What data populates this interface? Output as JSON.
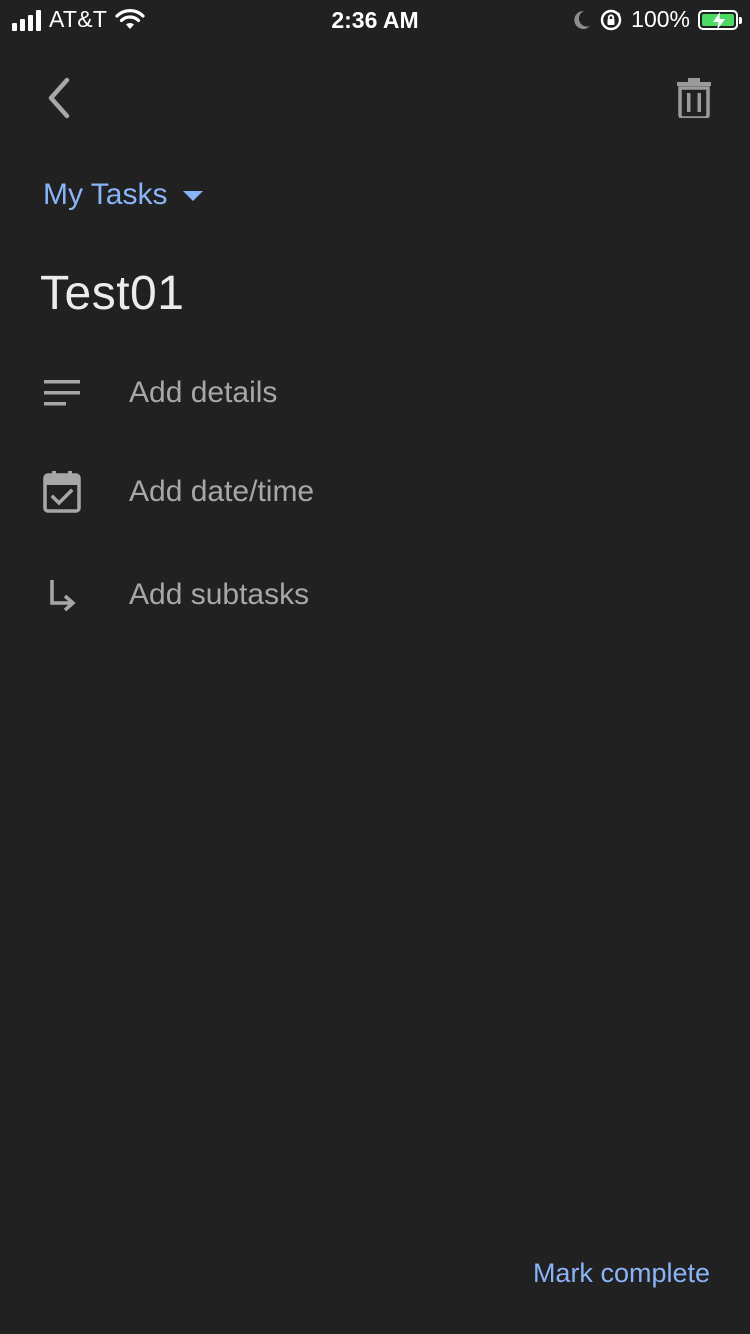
{
  "status_bar": {
    "carrier": "AT&T",
    "time": "2:36 AM",
    "battery": "100%",
    "battery_color": "#4cd964"
  },
  "toolbar": {
    "back_icon": "chevron-left-icon",
    "delete_icon": "trash-icon"
  },
  "list_selector": {
    "label": "My Tasks",
    "color": "#8ab4f8"
  },
  "task": {
    "title": "Test01"
  },
  "rows": {
    "details": {
      "label": "Add details",
      "icon": "notes-icon"
    },
    "date": {
      "label": "Add date/time",
      "icon": "calendar-check-icon"
    },
    "subtasks": {
      "label": "Add subtasks",
      "icon": "subtask-arrow-icon"
    }
  },
  "footer": {
    "mark_complete": "Mark complete"
  }
}
